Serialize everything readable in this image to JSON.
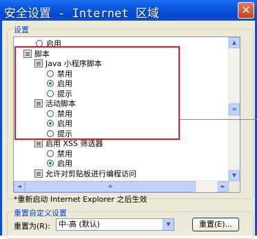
{
  "window": {
    "title": "安全设置 - Internet 区域",
    "close_glyph": "✕"
  },
  "settings_group": {
    "label": "设置"
  },
  "list_rows": [
    {
      "kind": "radio",
      "label": "启用",
      "checked": false
    },
    {
      "kind": "header",
      "label": "脚本"
    },
    {
      "kind": "header",
      "label": "Java 小程序脚本"
    },
    {
      "kind": "radio",
      "label": "禁用",
      "checked": false
    },
    {
      "kind": "radio",
      "label": "启用",
      "checked": true
    },
    {
      "kind": "radio",
      "label": "提示",
      "checked": false
    },
    {
      "kind": "header",
      "label": "活动脚本"
    },
    {
      "kind": "radio",
      "label": "禁用",
      "checked": false
    },
    {
      "kind": "radio",
      "label": "启用",
      "checked": true
    },
    {
      "kind": "radio",
      "label": "提示",
      "checked": false
    },
    {
      "kind": "header",
      "label": "启用 XSS 筛选器"
    },
    {
      "kind": "radio",
      "label": "禁用",
      "checked": false
    },
    {
      "kind": "radio",
      "label": "启用",
      "checked": true
    },
    {
      "kind": "header",
      "label": "允许对剪贴板进行编程访问"
    }
  ],
  "scroll_glyphs": {
    "up": "▲",
    "down": "▼",
    "left": "◄",
    "right": "►",
    "grip": "≡"
  },
  "note": "*重新启动 Internet Explorer 之后生效",
  "reset_group": {
    "label": "重置自定义设置",
    "reset_to_label": "重置为(R):",
    "selected_level": "中-高 (默认)",
    "dropdown_glyph": "▼",
    "reset_button": "重置(E)..."
  },
  "colors": {
    "title_bar": "#0a4fd4",
    "annotation_box": "#d71f1f",
    "radio_checked": "#21a121"
  }
}
